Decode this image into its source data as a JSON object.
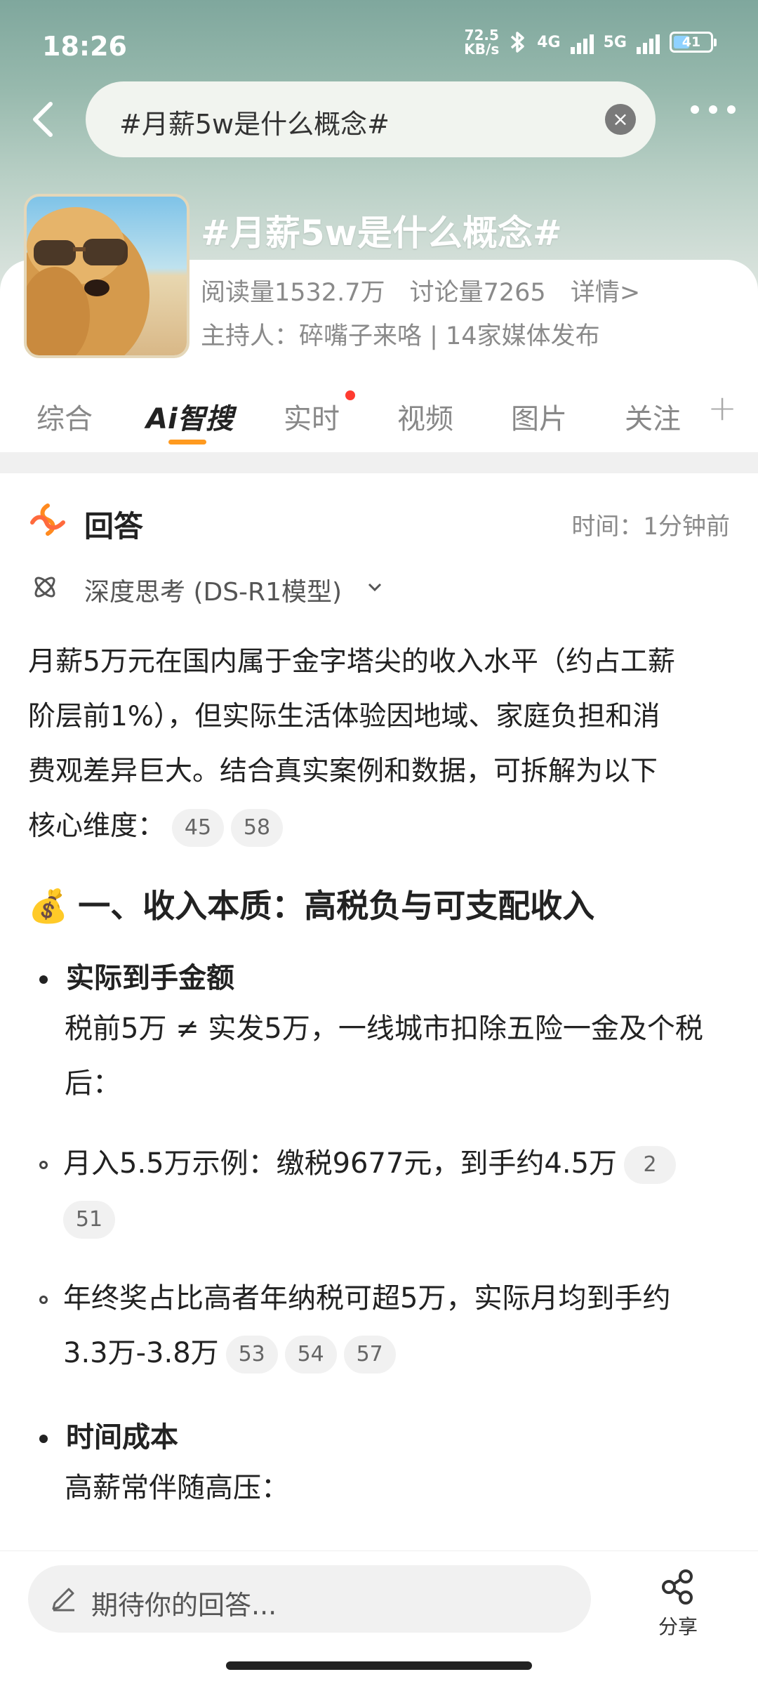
{
  "status_bar": {
    "time": "18:26",
    "net_speed_value": "72.5",
    "net_speed_unit": "KB/s",
    "signal_1": "4G",
    "signal_2": "5G",
    "battery": "41"
  },
  "search": {
    "value": "#月薪5w是什么概念#"
  },
  "topic": {
    "title": "#月薪5w是什么概念#",
    "reads": "阅读量1532.7万",
    "discussions": "讨论量7265",
    "details_link": "详情>",
    "host": "主持人：碎嘴子来咯 | 14家媒体发布"
  },
  "tabs": [
    {
      "label": "综合"
    },
    {
      "label": "Ai智搜"
    },
    {
      "label": "实时"
    },
    {
      "label": "视频"
    },
    {
      "label": "图片"
    },
    {
      "label": "关注"
    }
  ],
  "tab_plus": "+",
  "answer": {
    "title": "回答",
    "time": "时间：1分钟前",
    "thinking": "深度思考 (DS-R1模型)",
    "intro_lines": [
      "月薪5万元在国内属于金字塔尖的收入水平（约占工薪",
      "阶层前1%），但实际生活体验因地域、家庭负担和消",
      "费观差异巨大。结合真实案例和数据，可拆解为以下",
      "核心维度："
    ],
    "intro_refs": [
      "45",
      "58"
    ],
    "section1_emoji": "💰",
    "section1_title": "一、收入本质：高税负与可支配收入",
    "bullet1_title": "实际到手金额",
    "bullet1_line1": "税前5万 ≠ 实发5万，一线城市扣除五险一金及个税",
    "bullet1_line2": "后：",
    "sub1_line1": "月入5.5万示例：缴税9677元，到手约4.5万",
    "sub1_refs": [
      "2",
      "51"
    ],
    "sub2_line1": "年终奖占比高者年纳税可超5万，实际月均到手约",
    "sub2_line2": "3.3万-3.8万",
    "sub2_refs": [
      "53",
      "54",
      "57"
    ],
    "bullet2_title": "时间成本",
    "bullet2_line1": "高薪常伴随高压："
  },
  "bottom": {
    "reply_placeholder": "期待你的回答...",
    "share_label": "分享"
  },
  "colors": {
    "accent_orange": "#ff9a1f",
    "dot_red": "#ff3b30",
    "header_green": "#8fb3a7"
  }
}
